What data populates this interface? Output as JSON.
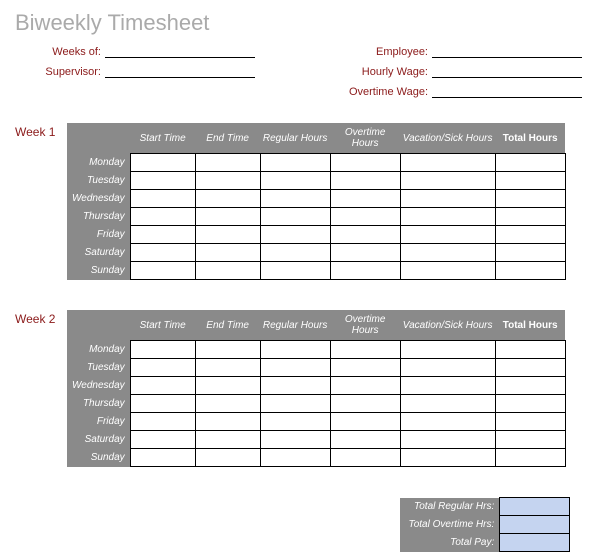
{
  "title": "Biweekly Timesheet",
  "header": {
    "left": [
      {
        "label": "Weeks of:"
      },
      {
        "label": "Supervisor:"
      }
    ],
    "right": [
      {
        "label": "Employee:"
      },
      {
        "label": "Hourly Wage:"
      },
      {
        "label": "Overtime Wage:"
      }
    ]
  },
  "columns": {
    "start": "Start Time",
    "end": "End Time",
    "regular": "Regular Hours",
    "overtime": "Overtime Hours",
    "vacation": "Vacation/Sick Hours",
    "total": "Total Hours"
  },
  "weeks": [
    {
      "label": "Week 1",
      "days": [
        "Monday",
        "Tuesday",
        "Wednesday",
        "Thursday",
        "Friday",
        "Saturday",
        "Sunday"
      ]
    },
    {
      "label": "Week 2",
      "days": [
        "Monday",
        "Tuesday",
        "Wednesday",
        "Thursday",
        "Friday",
        "Saturday",
        "Sunday"
      ]
    }
  ],
  "totals": {
    "regular": "Total Regular Hrs:",
    "overtime": "Total Overtime Hrs:",
    "pay": "Total Pay:"
  }
}
